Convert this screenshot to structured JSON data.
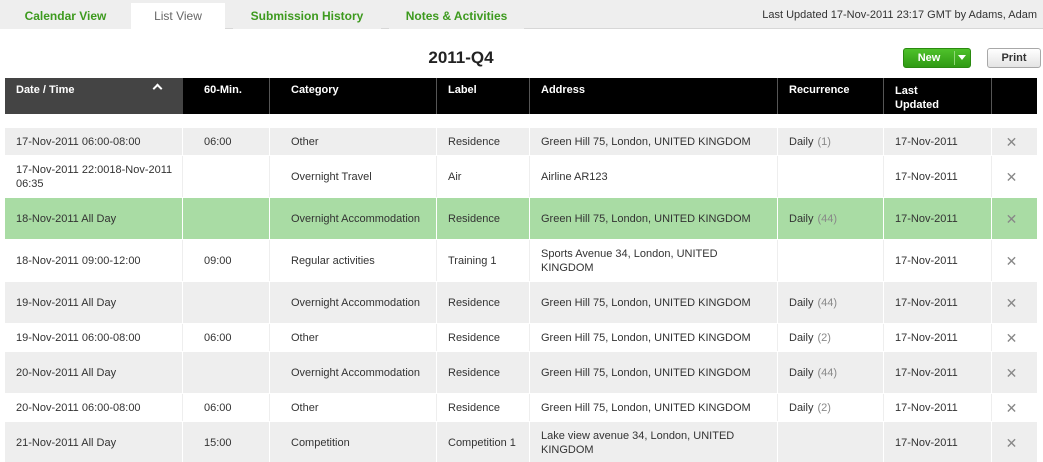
{
  "tabs": [
    {
      "label": "Calendar View",
      "active": false
    },
    {
      "label": "List View",
      "active": true
    },
    {
      "label": "Submission History",
      "active": false
    },
    {
      "label": "Notes & Activities",
      "active": false
    }
  ],
  "last_updated": "Last Updated 17-Nov-2011 23:17 GMT by Adams, Adam",
  "page_title": "2011-Q4",
  "buttons": {
    "new_label": "New",
    "print_label": "Print"
  },
  "columns": [
    "Date / Time",
    "60-Min.",
    "Category",
    "Label",
    "Address",
    "Recurrence",
    "Last Updated",
    ""
  ],
  "delete_glyph": "✕",
  "rows": [
    {
      "datetime": "17-Nov-2011 06:00-08:00",
      "sixty_min": "06:00",
      "category": "Other",
      "label": "Residence",
      "address": "Green Hill 75, London, UNITED KINGDOM",
      "recurrence": "Daily",
      "recurrence_count": "(1)",
      "last_updated": "17-Nov-2011",
      "highlight": false
    },
    {
      "datetime": "17-Nov-2011 22:0018-Nov-2011 06:35",
      "sixty_min": "",
      "category": "Overnight Travel",
      "label": "Air",
      "address": "Airline AR123",
      "recurrence": "",
      "recurrence_count": "",
      "last_updated": "17-Nov-2011",
      "highlight": false
    },
    {
      "datetime": "18-Nov-2011 All Day",
      "sixty_min": "",
      "category": "Overnight Accommodation",
      "label": "Residence",
      "address": "Green Hill 75, London, UNITED KINGDOM",
      "recurrence": "Daily",
      "recurrence_count": "(44)",
      "last_updated": "17-Nov-2011",
      "highlight": true
    },
    {
      "datetime": "18-Nov-2011 09:00-12:00",
      "sixty_min": "09:00",
      "category": "Regular activities",
      "label": "Training 1",
      "address": "Sports Avenue 34, London, UNITED KINGDOM",
      "recurrence": "",
      "recurrence_count": "",
      "last_updated": "17-Nov-2011",
      "highlight": false
    },
    {
      "datetime": "19-Nov-2011 All Day",
      "sixty_min": "",
      "category": "Overnight Accommodation",
      "label": "Residence",
      "address": "Green Hill 75, London, UNITED KINGDOM",
      "recurrence": "Daily",
      "recurrence_count": "(44)",
      "last_updated": "17-Nov-2011",
      "highlight": false
    },
    {
      "datetime": "19-Nov-2011 06:00-08:00",
      "sixty_min": "06:00",
      "category": "Other",
      "label": "Residence",
      "address": "Green Hill 75, London, UNITED KINGDOM",
      "recurrence": "Daily",
      "recurrence_count": "(2)",
      "last_updated": "17-Nov-2011",
      "highlight": false
    },
    {
      "datetime": "20-Nov-2011 All Day",
      "sixty_min": "",
      "category": "Overnight Accommodation",
      "label": "Residence",
      "address": "Green Hill 75, London, UNITED KINGDOM",
      "recurrence": "Daily",
      "recurrence_count": "(44)",
      "last_updated": "17-Nov-2011",
      "highlight": false
    },
    {
      "datetime": "20-Nov-2011 06:00-08:00",
      "sixty_min": "06:00",
      "category": "Other",
      "label": "Residence",
      "address": "Green Hill 75, London, UNITED KINGDOM",
      "recurrence": "Daily",
      "recurrence_count": "(2)",
      "last_updated": "17-Nov-2011",
      "highlight": false
    },
    {
      "datetime": "21-Nov-2011 All Day",
      "sixty_min": "15:00",
      "category": "Competition",
      "label": "Competition 1",
      "address": "Lake view avenue 34, London, UNITED KINGDOM",
      "recurrence": "",
      "recurrence_count": "",
      "last_updated": "17-Nov-2011",
      "highlight": false
    }
  ],
  "colors": {
    "tab_text": "#3d9a1e",
    "highlight_row": "#a9dca4",
    "header_bg": "#000000",
    "new_button": "#3aab1a"
  }
}
